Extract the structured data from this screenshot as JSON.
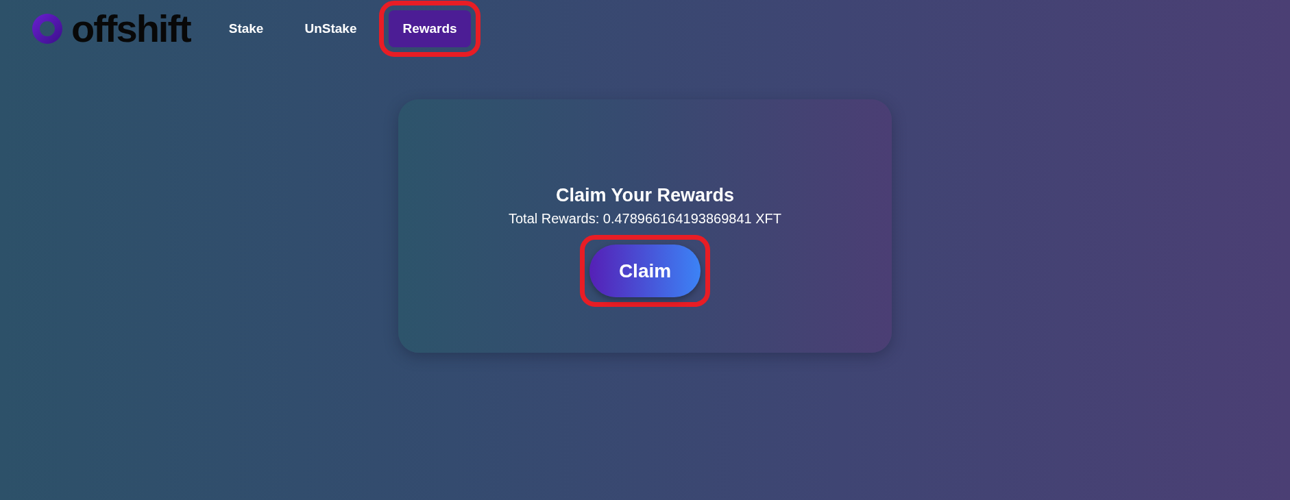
{
  "logo": {
    "text": "offshift"
  },
  "nav": [
    {
      "label": "Stake",
      "selected": false,
      "highlighted": false
    },
    {
      "label": "UnStake",
      "selected": false,
      "highlighted": false
    },
    {
      "label": "Rewards",
      "selected": true,
      "highlighted": true
    }
  ],
  "card": {
    "title": "Claim Your Rewards",
    "total": "Total Rewards: 0.478966164193869841 XFT",
    "button": {
      "label": "Claim",
      "highlighted": true
    }
  }
}
